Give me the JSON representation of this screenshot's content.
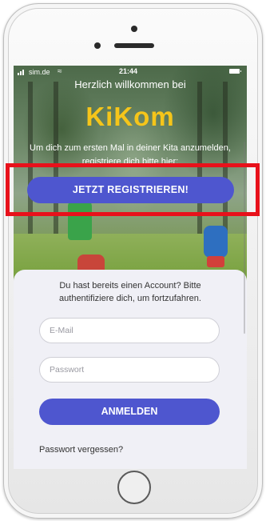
{
  "status_bar": {
    "carrier": "sim.de",
    "time": "21:44"
  },
  "header": {
    "welcome": "Herzlich willkommen bei",
    "logo": "KiKom",
    "intro": "Um dich zum ersten Mal in deiner Kita anzumelden, registriere dich bitte hier:"
  },
  "register_button": "JETZT REGISTRIEREN!",
  "login": {
    "prompt": "Du hast bereits einen Account? Bitte authentifiziere dich, um fortzufahren.",
    "email_placeholder": "E-Mail",
    "password_placeholder": "Passwort",
    "button": "ANMELDEN",
    "forgot": "Passwort vergessen?"
  },
  "colors": {
    "primary": "#4e56cf",
    "logo": "#f5c51a",
    "highlight": "#e8111b"
  },
  "icons": [
    "wifi-icon",
    "battery-icon",
    "signal-icon"
  ]
}
